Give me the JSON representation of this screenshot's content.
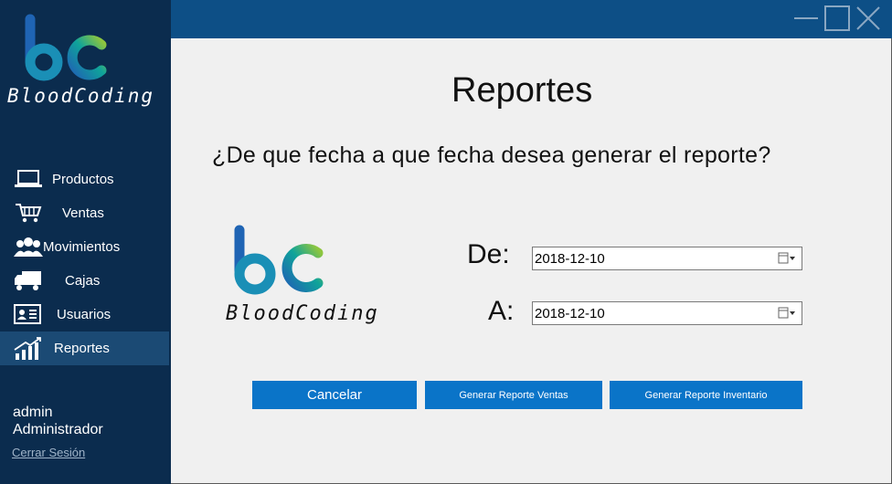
{
  "brand": {
    "logo_text": "BloodCoding",
    "colors": {
      "blue": "#1f64b4",
      "teal": "#0fa39a",
      "lime": "#8ec63f"
    }
  },
  "sidebar": {
    "items": [
      {
        "label": "Productos",
        "icon": "laptop-icon"
      },
      {
        "label": "Ventas",
        "icon": "shopping-cart-icon"
      },
      {
        "label": "Movimientos",
        "icon": "users-icon"
      },
      {
        "label": "Cajas",
        "icon": "truck-icon"
      },
      {
        "label": "Usuarios",
        "icon": "id-card-icon"
      },
      {
        "label": "Reportes",
        "icon": "bar-chart-icon",
        "active": true
      }
    ],
    "user": {
      "name": "admin",
      "role": "Administrador"
    },
    "logout_label": "Cerrar Sesión"
  },
  "window": {
    "controls": [
      "minimize-icon",
      "maximize-icon",
      "close-icon"
    ]
  },
  "main": {
    "title": "Reportes",
    "question": "¿De que fecha a que fecha desea generar el reporte?",
    "from_label": "De:",
    "from_date": "2018-12-10",
    "to_label": "A:",
    "to_date": "2018-12-10",
    "buttons": {
      "cancel": "Cancelar",
      "sales_report": "Generar Reporte Ventas",
      "inventory_report": "Generar Reporte Inventario"
    }
  },
  "theme": {
    "sidebar_bg": "#0b2c4e",
    "topbar_bg": "#0d4f86",
    "active_item_bg": "#1b4a74",
    "button_bg": "#0a74c8"
  }
}
